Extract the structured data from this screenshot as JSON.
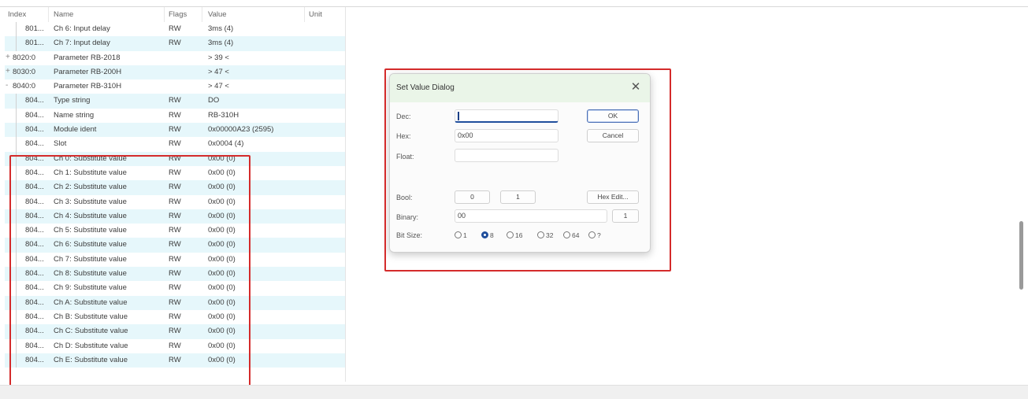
{
  "table": {
    "headers": {
      "index": "Index",
      "name": "Name",
      "flags": "Flags",
      "value": "Value",
      "unit": "Unit"
    },
    "rows": [
      {
        "expander": "",
        "index": "801...",
        "name": "Ch 6: Input delay",
        "flags": "RW",
        "value": "3ms (4)"
      },
      {
        "expander": "",
        "index": "801...",
        "name": "Ch 7: Input delay",
        "flags": "RW",
        "value": "3ms (4)"
      },
      {
        "expander": "+",
        "index": "8020:0",
        "name": "Parameter RB-2018",
        "flags": "",
        "value": "> 39 <"
      },
      {
        "expander": "+",
        "index": "8030:0",
        "name": "Parameter RB-200H",
        "flags": "",
        "value": "> 47 <"
      },
      {
        "expander": "-",
        "index": "8040:0",
        "name": "Parameter RB-310H",
        "flags": "",
        "value": "> 47 <"
      },
      {
        "expander": "",
        "index": "804...",
        "name": "Type string",
        "flags": "RW",
        "value": "DO"
      },
      {
        "expander": "",
        "index": "804...",
        "name": "Name string",
        "flags": "RW",
        "value": "RB-310H"
      },
      {
        "expander": "",
        "index": "804...",
        "name": "Module ident",
        "flags": "RW",
        "value": "0x00000A23 (2595)"
      },
      {
        "expander": "",
        "index": "804...",
        "name": "Slot",
        "flags": "RW",
        "value": "0x0004 (4)"
      },
      {
        "expander": "",
        "index": "804...",
        "name": "Ch 0: Substitute value",
        "flags": "RW",
        "value": "0x00 (0)"
      },
      {
        "expander": "",
        "index": "804...",
        "name": "Ch 1: Substitute value",
        "flags": "RW",
        "value": "0x00 (0)"
      },
      {
        "expander": "",
        "index": "804...",
        "name": "Ch 2: Substitute value",
        "flags": "RW",
        "value": "0x00 (0)"
      },
      {
        "expander": "",
        "index": "804...",
        "name": "Ch 3: Substitute value",
        "flags": "RW",
        "value": "0x00 (0)"
      },
      {
        "expander": "",
        "index": "804...",
        "name": "Ch 4: Substitute value",
        "flags": "RW",
        "value": "0x00 (0)"
      },
      {
        "expander": "",
        "index": "804...",
        "name": "Ch 5: Substitute value",
        "flags": "RW",
        "value": "0x00 (0)"
      },
      {
        "expander": "",
        "index": "804...",
        "name": "Ch 6: Substitute value",
        "flags": "RW",
        "value": "0x00 (0)"
      },
      {
        "expander": "",
        "index": "804...",
        "name": "Ch 7: Substitute value",
        "flags": "RW",
        "value": "0x00 (0)"
      },
      {
        "expander": "",
        "index": "804...",
        "name": "Ch 8: Substitute value",
        "flags": "RW",
        "value": "0x00 (0)"
      },
      {
        "expander": "",
        "index": "804...",
        "name": "Ch 9: Substitute value",
        "flags": "RW",
        "value": "0x00 (0)"
      },
      {
        "expander": "",
        "index": "804...",
        "name": "Ch A: Substitute value",
        "flags": "RW",
        "value": "0x00 (0)"
      },
      {
        "expander": "",
        "index": "804...",
        "name": "Ch B: Substitute value",
        "flags": "RW",
        "value": "0x00 (0)"
      },
      {
        "expander": "",
        "index": "804...",
        "name": "Ch C: Substitute value",
        "flags": "RW",
        "value": "0x00 (0)"
      },
      {
        "expander": "",
        "index": "804...",
        "name": "Ch D: Substitute value",
        "flags": "RW",
        "value": "0x00 (0)"
      },
      {
        "expander": "",
        "index": "804...",
        "name": "Ch E: Substitute value",
        "flags": "RW",
        "value": "0x00 (0)"
      }
    ]
  },
  "dialog": {
    "title": "Set Value Dialog",
    "close_icon": "close-icon",
    "dec": {
      "label": "Dec:",
      "value": ""
    },
    "hex": {
      "label": "Hex:",
      "value": "0x00"
    },
    "float": {
      "label": "Float:",
      "value": ""
    },
    "bool": {
      "label": "Bool:",
      "false_label": "0",
      "true_label": "1"
    },
    "binary": {
      "label": "Binary:",
      "value": "00",
      "byte_count": "1"
    },
    "bitsize": {
      "label": "Bit Size:",
      "options": [
        "1",
        "8",
        "16",
        "32",
        "64",
        "?"
      ],
      "selected": "8"
    },
    "buttons": {
      "ok": "OK",
      "cancel": "Cancel",
      "hex_edit": "Hex Edit..."
    }
  },
  "colors": {
    "highlight_border": "#d42b2b",
    "row_alt": "#e6f7fb",
    "dialog_title_bg": "#eaf5e8",
    "accent": "#1f4e9c"
  }
}
